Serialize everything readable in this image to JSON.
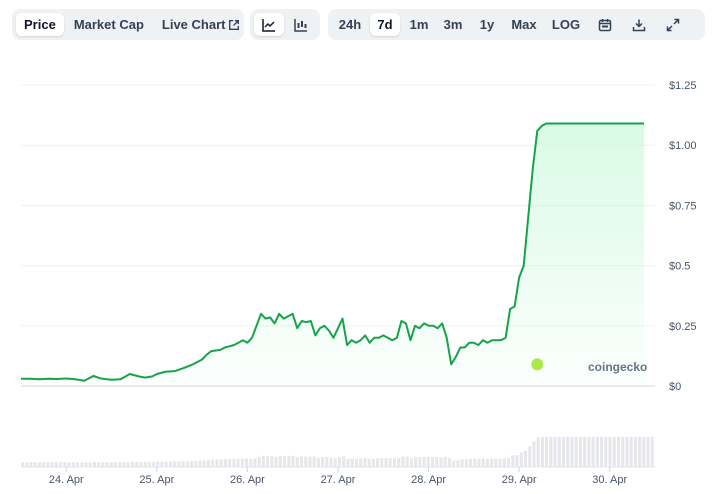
{
  "toolbar": {
    "metric_tabs": [
      {
        "label": "Price",
        "active": true
      },
      {
        "label": "Market Cap",
        "active": false
      },
      {
        "label": "Live Chart",
        "active": false
      }
    ],
    "chart_types": [
      {
        "icon": "line-chart-icon",
        "active": true
      },
      {
        "icon": "candlestick-chart-icon",
        "active": false
      }
    ],
    "ranges": [
      {
        "label": "24h",
        "active": false
      },
      {
        "label": "7d",
        "active": true
      },
      {
        "label": "1m",
        "active": false
      },
      {
        "label": "3m",
        "active": false
      },
      {
        "label": "1y",
        "active": false
      },
      {
        "label": "Max",
        "active": false
      },
      {
        "label": "LOG",
        "active": false
      }
    ],
    "tools": [
      "calendar-icon",
      "download-icon",
      "expand-icon"
    ]
  },
  "watermark": "coingecko",
  "colors": {
    "line": "#16a34a",
    "fill": "#bbf7d0",
    "grid": "#eef0f3",
    "volume": "#e5e7eb",
    "marker": "#a3e635"
  },
  "chart_data": {
    "type": "line",
    "title": "",
    "xlabel": "",
    "ylabel": "",
    "ylim": [
      0,
      1.25
    ],
    "yticks": [
      "$1.25",
      "$1.00",
      "$0.75",
      "$0.5",
      "$0.25",
      "$0"
    ],
    "ytick_values": [
      1.25,
      1.0,
      0.75,
      0.5,
      0.25,
      0
    ],
    "xticks": [
      "24. Apr",
      "25. Apr",
      "26. Apr",
      "27. Apr",
      "28. Apr",
      "29. Apr",
      "30. Apr"
    ],
    "xtick_positions": [
      1,
      2,
      3,
      4,
      5,
      6,
      7
    ],
    "xlim": [
      0.5,
      7.5
    ],
    "grid": true,
    "series": [
      {
        "x": [
          0.5,
          0.6,
          0.7,
          0.8,
          0.9,
          1.0,
          1.1,
          1.2,
          1.3,
          1.35,
          1.4,
          1.5,
          1.6,
          1.7,
          1.8,
          1.87,
          1.95,
          2.0,
          2.1,
          2.2,
          2.3,
          2.4,
          2.45,
          2.5,
          2.55,
          2.6,
          2.7,
          2.75,
          2.8,
          2.85,
          2.9,
          2.95,
          3.0,
          3.05,
          3.1,
          3.15,
          3.2,
          3.25,
          3.3,
          3.35,
          3.4,
          3.45,
          3.5,
          3.55,
          3.6,
          3.65,
          3.7,
          3.75,
          3.8,
          3.85,
          3.9,
          3.95,
          4.0,
          4.05,
          4.1,
          4.15,
          4.2,
          4.25,
          4.3,
          4.35,
          4.4,
          4.45,
          4.5,
          4.55,
          4.6,
          4.65,
          4.7,
          4.75,
          4.8,
          4.85,
          4.9,
          4.95,
          5.0,
          5.05,
          5.1,
          5.15,
          5.2,
          5.25,
          5.3,
          5.35,
          5.4,
          5.45,
          5.5,
          5.55,
          5.6,
          5.65,
          5.7,
          5.75,
          5.8,
          5.85,
          5.9,
          5.95,
          6.0,
          6.05,
          6.1,
          6.15,
          6.2,
          6.25,
          6.3,
          6.35,
          6.4,
          6.45,
          6.5,
          6.55,
          6.6,
          6.65,
          6.7,
          6.75,
          6.8,
          6.85,
          6.9,
          6.95,
          7.0,
          7.05,
          7.1,
          7.15,
          7.2,
          7.22,
          7.26,
          7.3,
          7.35,
          7.38
        ],
        "y": [
          0.03,
          0.03,
          0.028,
          0.03,
          0.029,
          0.031,
          0.028,
          0.022,
          0.042,
          0.035,
          0.03,
          0.026,
          0.028,
          0.05,
          0.04,
          0.035,
          0.04,
          0.05,
          0.06,
          0.062,
          0.075,
          0.09,
          0.1,
          0.11,
          0.13,
          0.145,
          0.15,
          0.16,
          0.165,
          0.17,
          0.18,
          0.19,
          0.18,
          0.2,
          0.25,
          0.3,
          0.28,
          0.285,
          0.26,
          0.3,
          0.28,
          0.29,
          0.3,
          0.24,
          0.27,
          0.265,
          0.27,
          0.21,
          0.24,
          0.25,
          0.23,
          0.2,
          0.24,
          0.28,
          0.17,
          0.19,
          0.18,
          0.19,
          0.21,
          0.18,
          0.2,
          0.2,
          0.21,
          0.2,
          0.19,
          0.2,
          0.27,
          0.26,
          0.19,
          0.25,
          0.24,
          0.26,
          0.25,
          0.25,
          0.24,
          0.26,
          0.2,
          0.09,
          0.12,
          0.16,
          0.16,
          0.18,
          0.18,
          0.17,
          0.19,
          0.18,
          0.19,
          0.19,
          0.19,
          0.2,
          0.32,
          0.33,
          0.45,
          0.5,
          0.7,
          0.9,
          1.06,
          1.08,
          1.09,
          1.09,
          1.09,
          1.09,
          1.09,
          1.09,
          1.09,
          1.09,
          1.09,
          1.09,
          1.09,
          1.09,
          1.09,
          1.09,
          1.09,
          1.09,
          1.09,
          1.09,
          1.09,
          1.09,
          1.09,
          1.09,
          1.09,
          1.09
        ]
      }
    ],
    "marker": {
      "x": 6.2,
      "y": 0.09
    }
  }
}
